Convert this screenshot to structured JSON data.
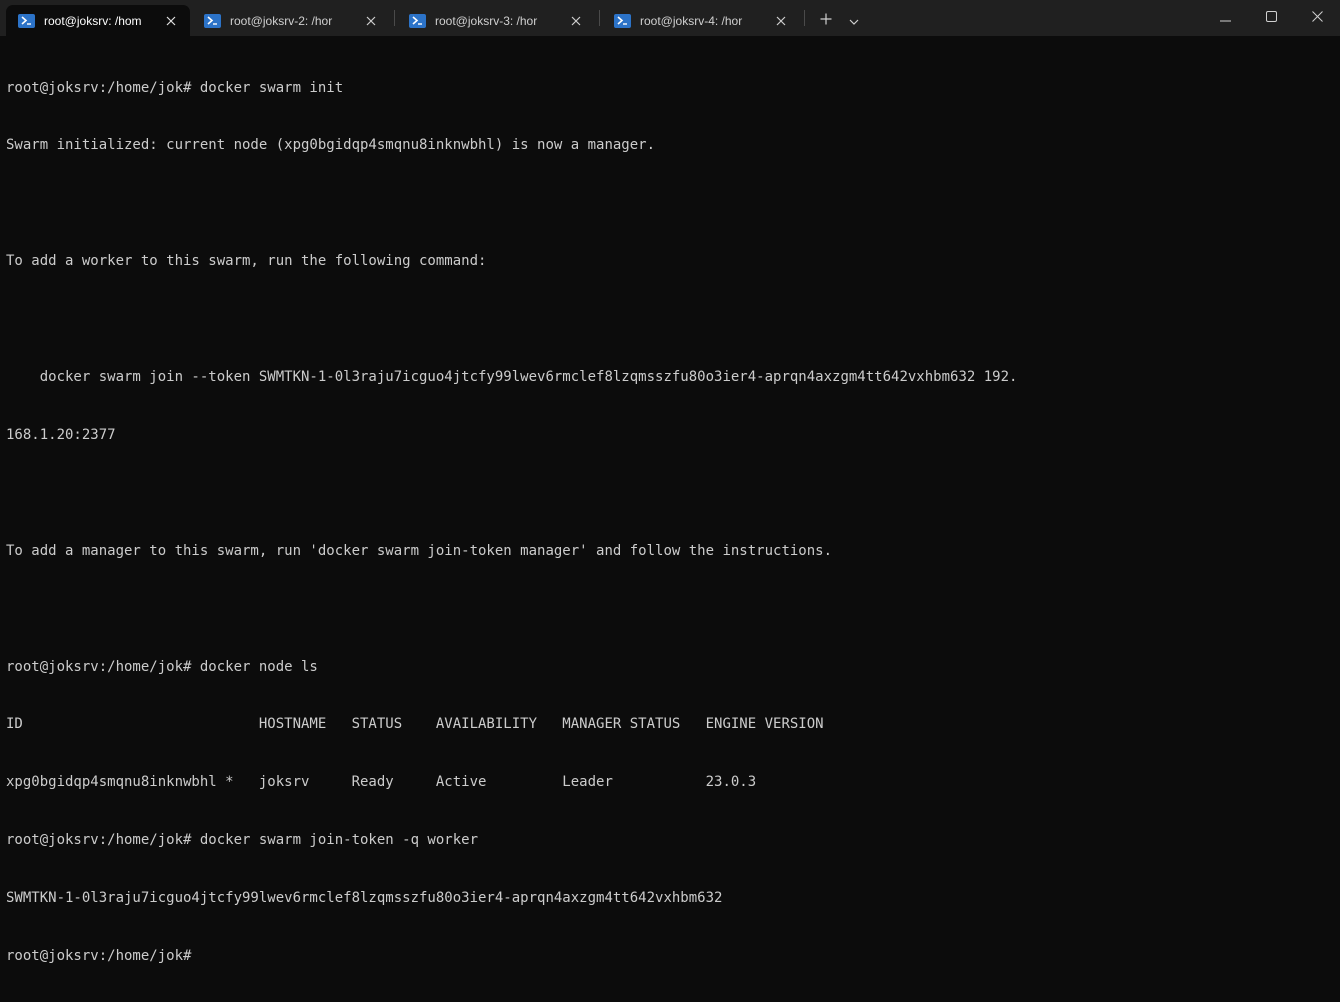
{
  "tabs": [
    {
      "title": "root@joksrv: /hom",
      "active": true
    },
    {
      "title": "root@joksrv-2: /hor",
      "active": false
    },
    {
      "title": "root@joksrv-3: /hor",
      "active": false
    },
    {
      "title": "root@joksrv-4: /hor",
      "active": false
    }
  ],
  "icons": {
    "tab_icon": "powershell-icon",
    "close": "close-icon",
    "new_tab": "plus-icon",
    "dropdown": "chevron-down-icon",
    "minimize": "minimize-icon",
    "maximize": "maximize-icon",
    "window_close": "window-close-icon"
  },
  "colors": {
    "tabbar": "#202020",
    "terminal_bg": "#0c0c0c",
    "terminal_fg": "#cccccc",
    "tab_icon": "#2c73c8"
  },
  "terminal": {
    "lines": [
      "root@joksrv:/home/jok# docker swarm init",
      "Swarm initialized: current node (xpg0bgidqp4smqnu8inknwbhl) is now a manager.",
      "",
      "To add a worker to this swarm, run the following command:",
      "",
      "    docker swarm join --token SWMTKN-1-0l3raju7icguo4jtcfy99lwev6rmclef8lzqmsszfu80o3ier4-aprqn4axzgm4tt642vxhbm632 192.",
      "168.1.20:2377",
      "",
      "To add a manager to this swarm, run 'docker swarm join-token manager' and follow the instructions.",
      "",
      "root@joksrv:/home/jok# docker node ls",
      "ID                            HOSTNAME   STATUS    AVAILABILITY   MANAGER STATUS   ENGINE VERSION",
      "xpg0bgidqp4smqnu8inknwbhl *   joksrv     Ready     Active         Leader           23.0.3",
      "root@joksrv:/home/jok# docker swarm join-token -q worker",
      "SWMTKN-1-0l3raju7icguo4jtcfy99lwev6rmclef8lzqmsszfu80o3ier4-aprqn4axzgm4tt642vxhbm632",
      "root@joksrv:/home/jok#"
    ]
  }
}
